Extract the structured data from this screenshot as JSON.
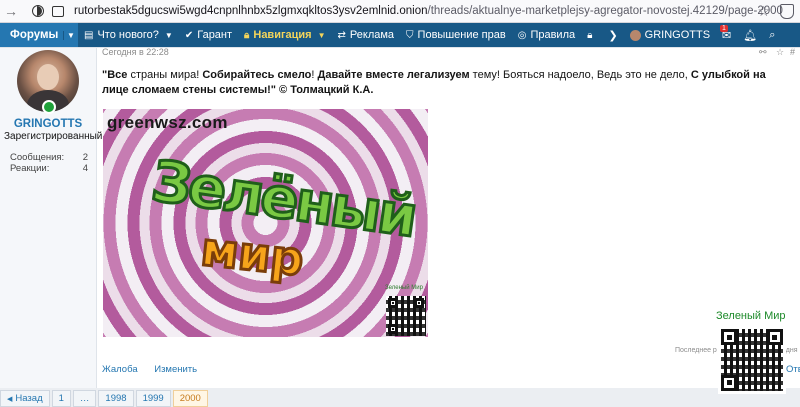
{
  "browser": {
    "url_host": "rutorbestak5dgucswi5wgd4cnpnlhnbx5zlgmxqkltos3ysv2emlnid.onion",
    "url_path": "/threads/aktualnye-marketplejsy-agregator-novostej.42129/page-2000"
  },
  "navbar": {
    "forums_label": "Форумы",
    "items": [
      {
        "label": "Что нового?",
        "icon": "list-icon"
      },
      {
        "label": "Гарант",
        "icon": "check-circle-icon"
      },
      {
        "label": "Навигация",
        "icon": "lock-icon"
      },
      {
        "label": "Реклама",
        "icon": "arrows-icon"
      },
      {
        "label": "Повышение прав",
        "icon": "shield-icon"
      },
      {
        "label": "Правила",
        "icon": "target-icon"
      },
      {
        "label": "GRINGOTTS",
        "icon": "avatar-icon"
      }
    ],
    "notif_count": "1"
  },
  "user": {
    "name": "GRINGOTTS",
    "title": "Зарегистрированный",
    "stats": [
      {
        "label": "Сообщения:",
        "value": "2"
      },
      {
        "label": "Реакции:",
        "value": "4"
      }
    ]
  },
  "post": {
    "date": "Сегодня в 22:28",
    "number": "#",
    "text_parts": {
      "p1": "\"Все",
      "p2": " страны мира! ",
      "p3": "Собирайтесь смело",
      "p4": "! ",
      "p5": "Давайте вместе легализуем",
      "p6": " тему! Бояться надоело, Ведь это не дело, ",
      "p7": "С улыбкой на лице",
      "p8": " сломаем стены системы!\" © Толмацкий К.А."
    },
    "image": {
      "domain": "greenwsz.com",
      "graffiti_line1": "Зелёный",
      "graffiti_line2": "мир",
      "brand": "Зеленый Мир"
    },
    "actions": {
      "report": "Жалоба",
      "edit": "Изменить"
    },
    "last_edit_left": "Последнее р",
    "last_edit_right": "одня",
    "reply_stub": "Отв"
  },
  "side_brand": "Зеленый Мир",
  "pagination": {
    "prev": "Назад",
    "pages": [
      "1",
      "…",
      "1998",
      "1999",
      "2000"
    ],
    "current": "2000"
  }
}
